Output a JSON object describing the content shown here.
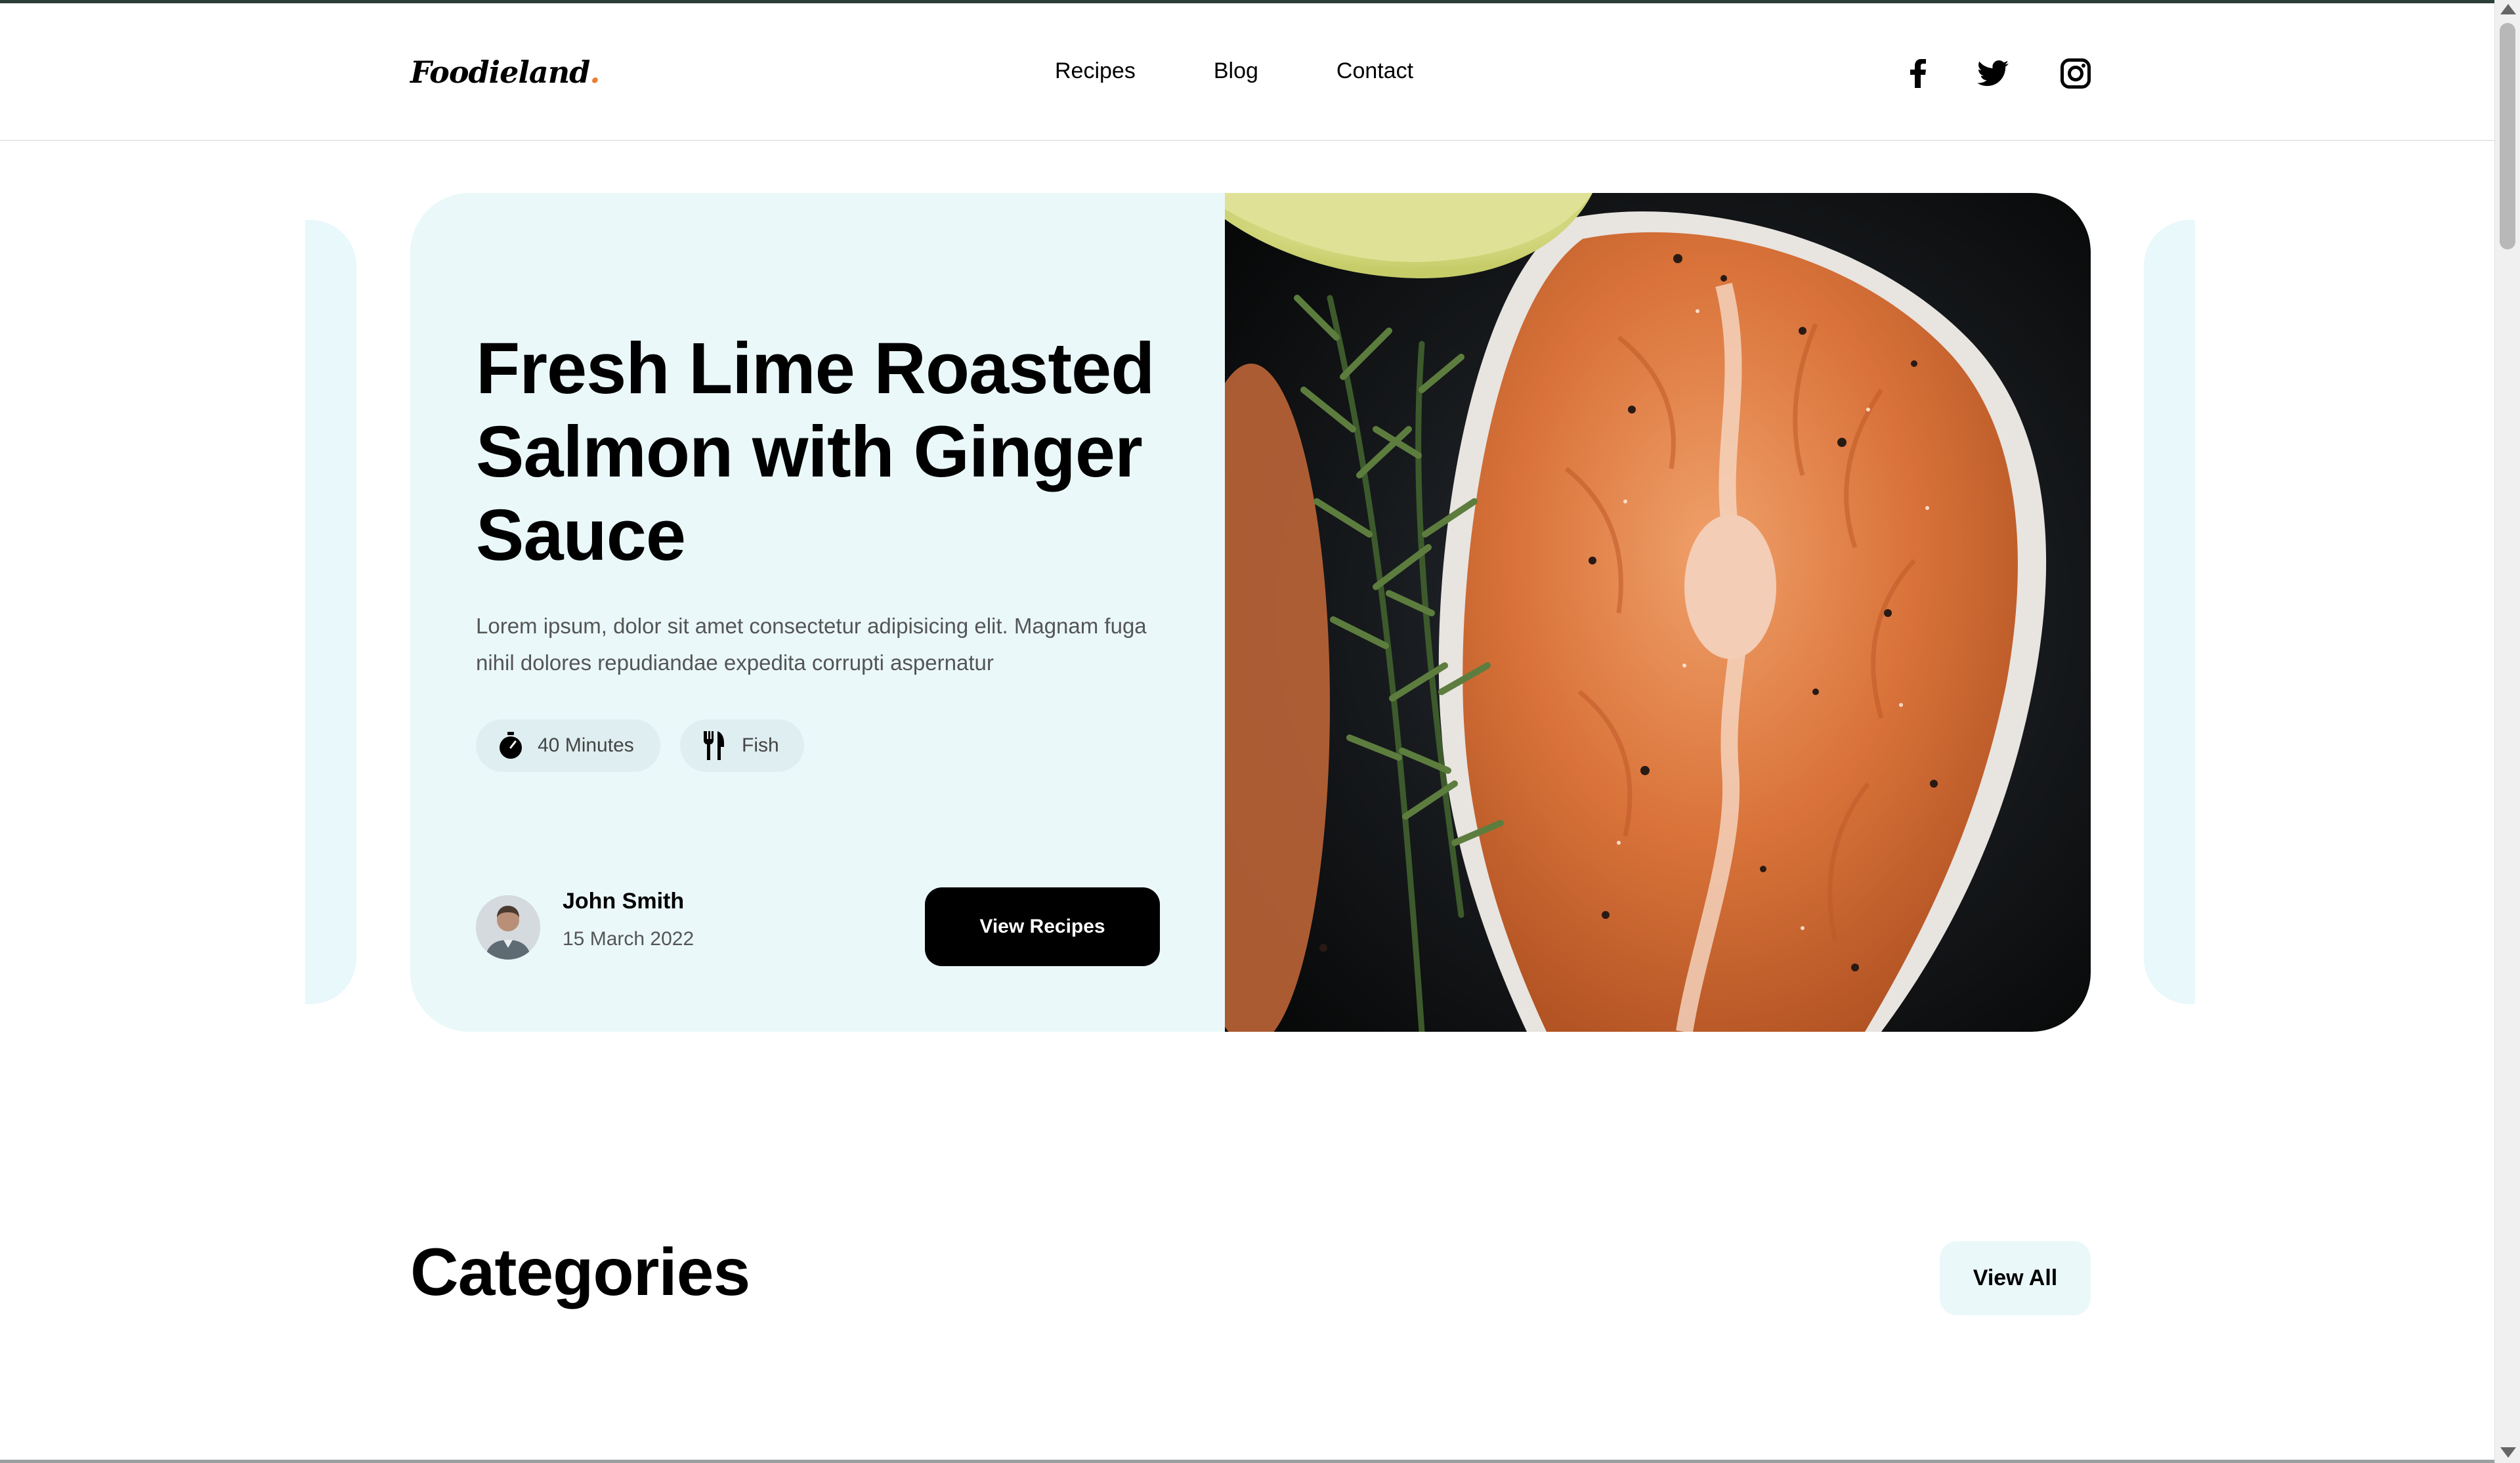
{
  "header": {
    "logo_text": "Foodieland",
    "logo_dot": ".",
    "nav": [
      "Recipes",
      "Blog",
      "Contact"
    ],
    "social_icons": [
      "facebook-icon",
      "twitter-icon",
      "instagram-icon"
    ]
  },
  "hero": {
    "title": "Fresh Lime Roasted Salmon with Ginger Sauce",
    "description": "Lorem ipsum, dolor sit amet consectetur adipisicing elit. Magnam fuga nihil dolores repudiandae expedita corrupti aspernatur",
    "chips": [
      {
        "icon": "timer-icon",
        "label": "40 Minutes"
      },
      {
        "icon": "fork-knife-icon",
        "label": "Fish"
      }
    ],
    "author": {
      "name": "John Smith",
      "date": "15 March 2022"
    },
    "button_label": "View Recipes"
  },
  "categories": {
    "title": "Categories",
    "view_all_label": "View All"
  },
  "colors": {
    "hero_bg": "#eaf8fa",
    "button_bg": "#000000",
    "logo_accent": "#e97d36"
  }
}
